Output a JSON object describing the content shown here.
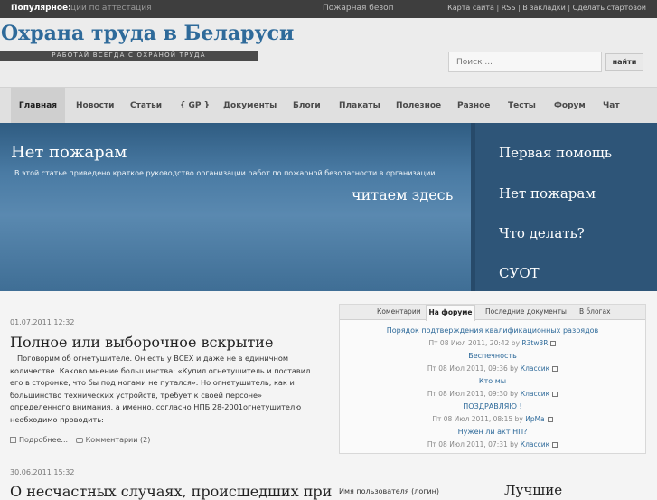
{
  "topbar": {
    "popular_label": "Популярное:",
    "popular_items": [
      "ции по аттестация",
      "Пожарная безоп"
    ],
    "links": [
      "Карта сайта",
      "RSS",
      "В закладки",
      "Сделать стартовой"
    ]
  },
  "header": {
    "site_title": "Охрана труда в Беларуси",
    "slogan": "РАБОТАЙ ВСЕГДА С ОХРАНОЙ ТРУДА",
    "search_placeholder": "Поиск ...",
    "search_button": "найти"
  },
  "nav": {
    "items": [
      "Главная",
      "Новости",
      "Статьи",
      "{ GP }",
      "Документы",
      "Блоги",
      "Плакаты",
      "Полезное",
      "Разное",
      "Тесты",
      "Форум",
      "Чат"
    ],
    "active": "Главная"
  },
  "banner": {
    "title": "Нет пожарам",
    "text": "В этой статье приведено краткое руководство организации работ по  пожарной безопасности в организации.",
    "read_link": "читаем здесь",
    "side_links": [
      "Первая помощь",
      "Нет пожарам",
      "Что делать?",
      "СУОТ"
    ]
  },
  "posts": [
    {
      "date": "01.07.2011 12:32",
      "title": "Полное или выборочное вскрытие",
      "body_lines": [
        "Поговорим об огнетушителе. Он есть у ВСЕХ и даже не в единичном",
        "количестве. Каково мнение большинства: «Купил огнетушитель и поставил",
        "его в сторонке, что бы под ногами не путался». Но огнетушитель, как и",
        "большинство технических устройств, требует к   своей персоне»",
        "определенного внимания, а именно, согласно НПБ 28-2001огнетушителю",
        "необходимо проводить:"
      ],
      "more_link": "Подробнее...",
      "comments_link": "Комментарии (2)"
    },
    {
      "date": "30.06.2011 15:32",
      "title": "О несчастных случаях, происшедших при"
    }
  ],
  "forum_widget": {
    "tabs": [
      "Коментарии",
      "На форуме",
      "Последние документы",
      "В блогах"
    ],
    "active_tab": "На форуме",
    "topics": [
      {
        "title": "Порядок подтверждения квалификационных разрядов",
        "date": "Пт 08 Июл 2011, 20:42 by",
        "author": "R3tw3R"
      },
      {
        "title": "Беспечность",
        "date": "Пт 08 Июл 2011, 09:36 by",
        "author": "Классик"
      },
      {
        "title": "Кто мы",
        "date": "Пт 08 Июл 2011, 09:30 by",
        "author": "Классик"
      },
      {
        "title": "ПОЗДРАВЛЯЮ !",
        "date": "Пт 08 Июл 2011, 08:15 by",
        "author": "ИрМа"
      },
      {
        "title": "Нужен ли акт НП?",
        "date": "Пт 08 Июл 2011, 07:31 by",
        "author": "Классик"
      }
    ]
  },
  "sidebar_bottom": {
    "login_label": "Имя пользователя (логин)",
    "best_title": "Лучшие"
  }
}
